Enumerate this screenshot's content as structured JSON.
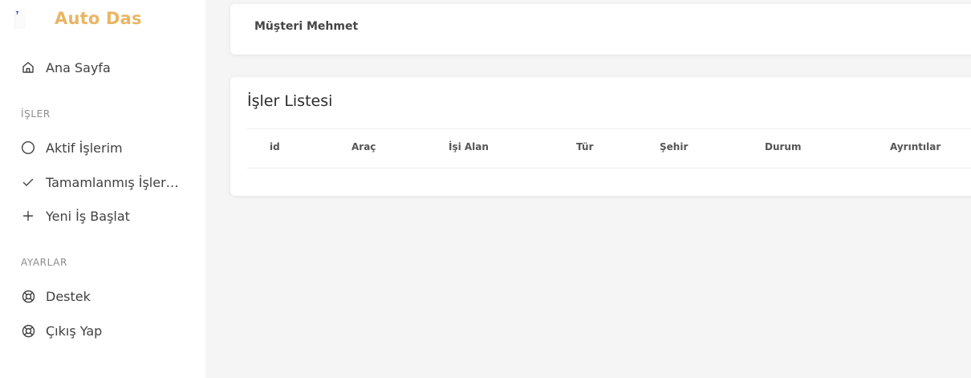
{
  "brand": {
    "name": "Auto Das"
  },
  "sidebar": {
    "home": "Ana Sayfa",
    "section_jobs": "İŞLER",
    "active_jobs": "Aktif İşlerim",
    "completed_jobs": "Tamamlanmış İşleri…",
    "new_job": "Yeni İş Başlat",
    "section_settings": "AYARLAR",
    "support": "Destek",
    "logout": "Çıkış Yap"
  },
  "user": {
    "name": "Müşteri Mehmet"
  },
  "jobs": {
    "title": "İşler Listesi",
    "columns": [
      "id",
      "Araç",
      "İşi Alan",
      "Tür",
      "Şehir",
      "Durum",
      "Ayrıntılar"
    ],
    "rows": []
  },
  "colors": {
    "brand": "#e9b564",
    "background": "#f5f5f5",
    "sidebar": "#ffffff"
  }
}
